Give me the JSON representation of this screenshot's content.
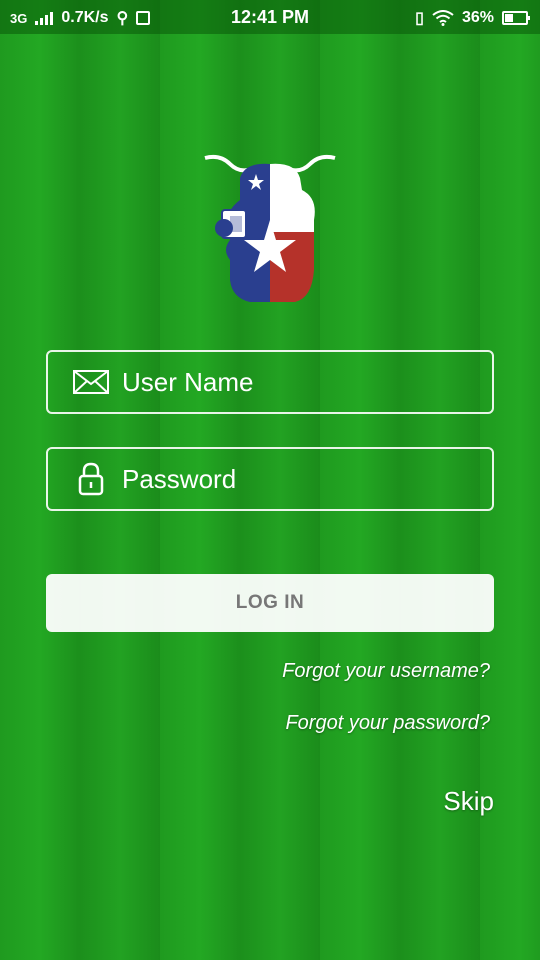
{
  "status_bar": {
    "network": "3G",
    "speed": "0.7K/s",
    "time": "12:41 PM",
    "battery": "36%"
  },
  "logo": {
    "icon": "longhorn-texas-flag-logo"
  },
  "form": {
    "username_placeholder": "User Name",
    "password_placeholder": "Password",
    "login_label": "LOG IN"
  },
  "links": {
    "forgot_username": "Forgot your username?",
    "forgot_password": "Forgot your password?",
    "skip": "Skip"
  }
}
